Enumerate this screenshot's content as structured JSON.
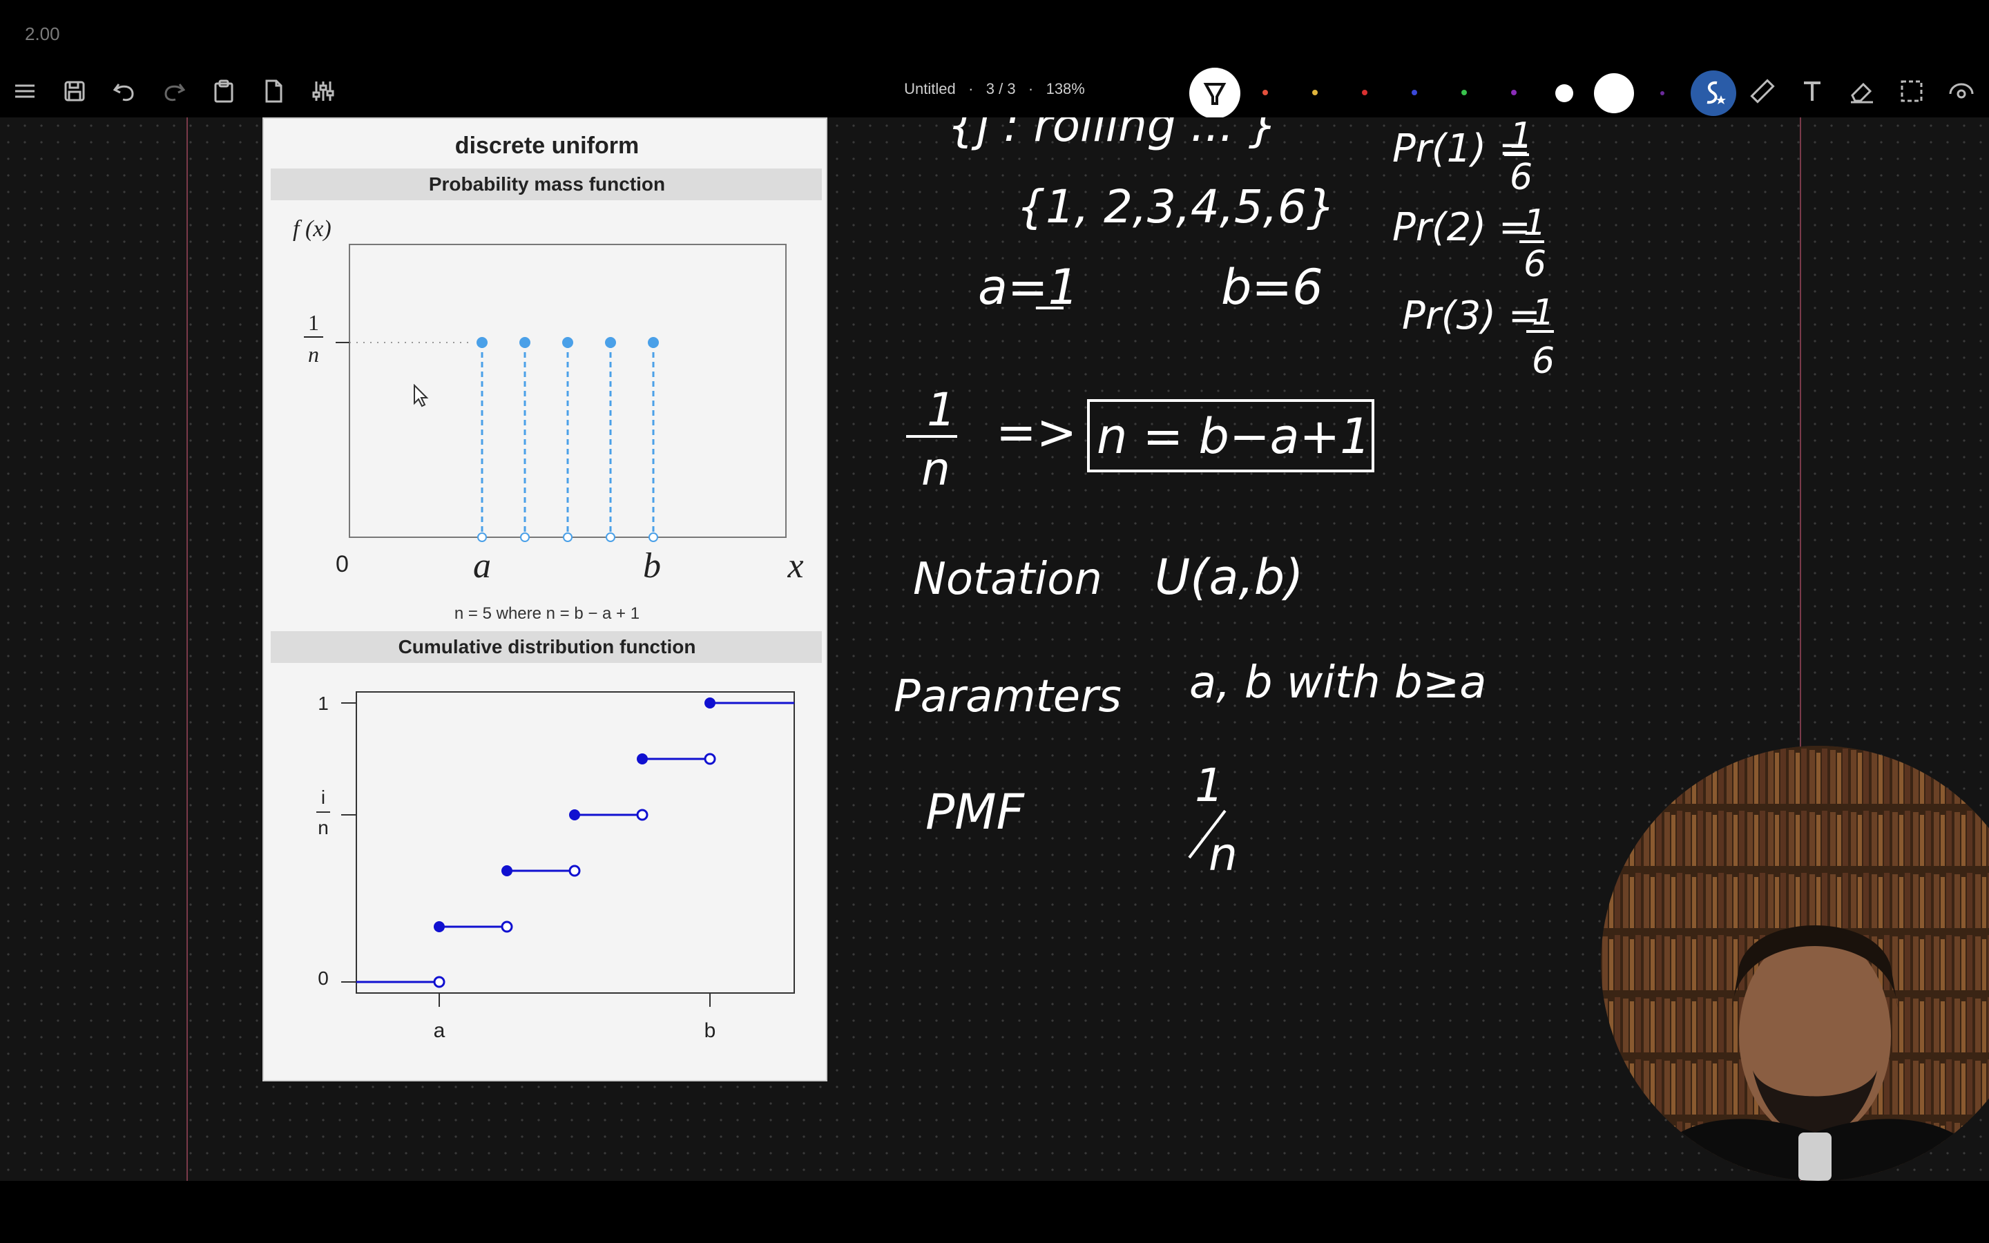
{
  "top_label": "2.00",
  "toolbar": {
    "title": "Untitled",
    "page": "3 / 3",
    "zoom": "138%",
    "sep": "·",
    "colors": [
      "#e3503c",
      "#e0b43c",
      "#d93030",
      "#3a48d8",
      "#38c24c",
      "#8a2cb8",
      "#ffffff"
    ]
  },
  "ref": {
    "title": "discrete uniform",
    "pmf_header": "Probability mass function",
    "pmf_ylabel": "f (x)",
    "pmf_one": "1",
    "pmf_n": "n",
    "pmf_zero": "0",
    "pmf_a": "a",
    "pmf_b": "b",
    "pmf_x": "x",
    "pmf_caption": "n = 5 where n = b − a + 1",
    "cdf_header": "Cumulative distribution function",
    "cdf_one": "1",
    "cdf_i": "i",
    "cdf_n": "n",
    "cdf_zero": "0",
    "cdf_a": "a",
    "cdf_b": "b"
  },
  "notes": {
    "set": "{1, 2,3,4,5,6}",
    "a_eq": "a=1",
    "b_eq": "b=6",
    "pr1": "Pr(1) =",
    "pr2": "Pr(2) =",
    "pr3": "Pr(3) =",
    "frac_num": "1",
    "frac_den": "6",
    "one": "1",
    "n": "n",
    "implies": "=>",
    "formula": "n = b−a+1",
    "notation_label": "Notation",
    "notation_value": "U(a,b)",
    "params_label": "Paramters",
    "params_value": "a, b  with  b≥a",
    "pmf_label": "PMF",
    "top_partial": "{j : rolling ... }"
  }
}
